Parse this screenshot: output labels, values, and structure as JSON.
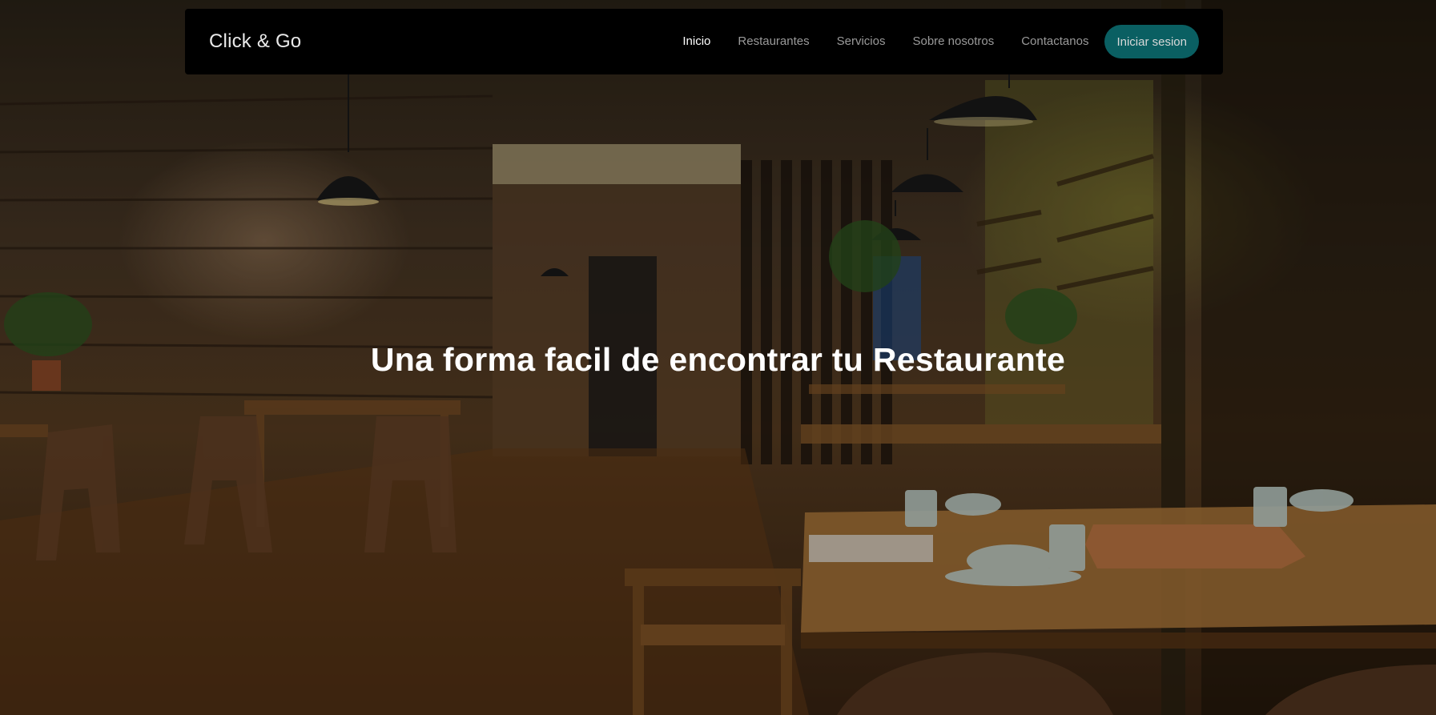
{
  "navbar": {
    "brand": "Click & Go",
    "links": [
      {
        "label": "Inicio",
        "active": true
      },
      {
        "label": "Restaurantes",
        "active": false
      },
      {
        "label": "Servicios",
        "active": false
      },
      {
        "label": "Sobre nosotros",
        "active": false
      },
      {
        "label": "Contactanos",
        "active": false
      }
    ],
    "login_label": "Iniciar sesion"
  },
  "hero": {
    "headline": "Una forma facil de encontrar tu Restaurante",
    "background_image": "restaurant-interior-photo"
  },
  "colors": {
    "navbar_bg": "#000000",
    "login_button_bg": "#0a5f62",
    "active_link": "#ffffff",
    "inactive_link": "#9a9a9a"
  }
}
